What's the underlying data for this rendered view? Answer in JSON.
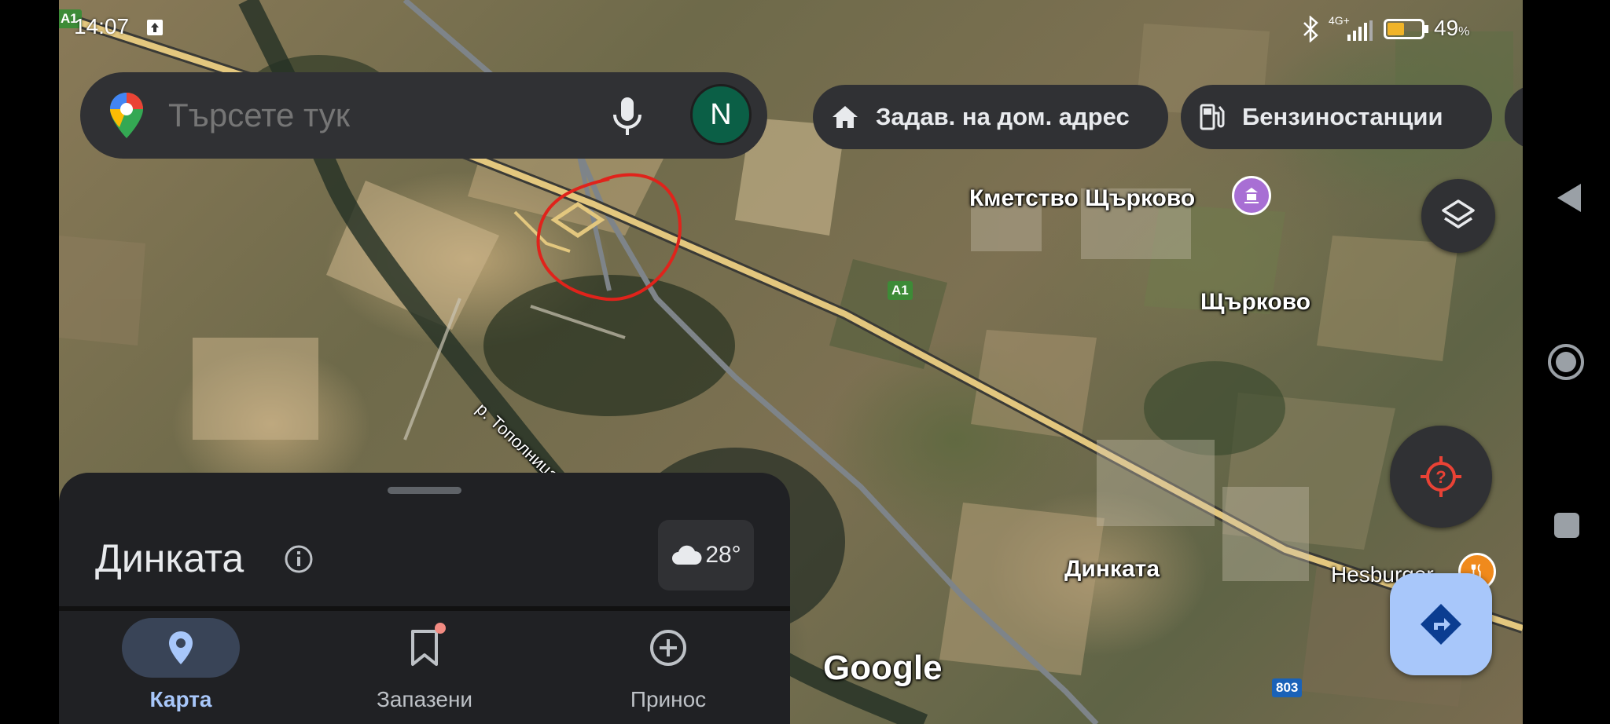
{
  "status_bar": {
    "time": "14:07",
    "network": "4G+",
    "battery_percent": "49",
    "battery_suffix": "%",
    "battery_level": 0.49
  },
  "search": {
    "placeholder": "Търсете тук",
    "avatar_letter": "N"
  },
  "chips": [
    {
      "label": "Задав. на дом. адрес",
      "icon": "home-icon"
    },
    {
      "label": "Бензиностанции",
      "icon": "gas-station-icon"
    }
  ],
  "map": {
    "place_labels": {
      "town_hall": "Кметство Щърково",
      "village": "Щърково",
      "river": "р. Тополница",
      "dinkata": "Динката",
      "restaurant": "Hesburger",
      "google_logo": "Google"
    },
    "road_shields": {
      "a1_top": "A1",
      "a1_mid": "A1",
      "r803": "803"
    },
    "colors": {
      "motorway": "#e3c77e",
      "road": "#8a8f93",
      "annotation": "#e0231b",
      "a1_shield": "#3d8b37",
      "r803_shield": "#1a62b8"
    }
  },
  "sheet": {
    "title": "Динката",
    "weather_temp": "28°"
  },
  "bottom_nav": [
    {
      "label": "Карта",
      "icon": "map-pin-icon",
      "active": true
    },
    {
      "label": "Запазени",
      "icon": "bookmark-icon",
      "active": false
    },
    {
      "label": "Принос",
      "icon": "add-circle-icon",
      "active": false
    }
  ],
  "system_nav": {
    "back": "back-icon",
    "home": "home-circle-icon",
    "recents": "recents-icon"
  }
}
